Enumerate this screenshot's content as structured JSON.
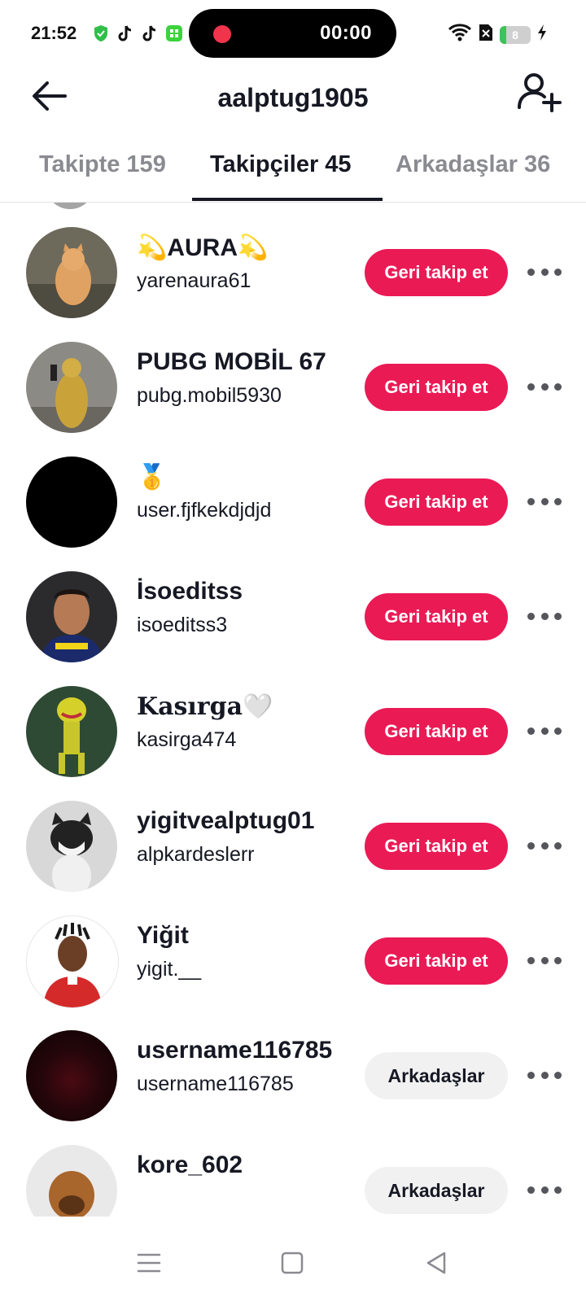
{
  "status_bar": {
    "time": "21:52",
    "recording_timer": "00:00",
    "battery_level": "8",
    "record_color": "#f0344c"
  },
  "header": {
    "title": "aalptug1905",
    "back_icon": "arrow-left-icon",
    "add_icon": "add-user-icon"
  },
  "tabs": [
    {
      "label": "Takipte 159",
      "active": false
    },
    {
      "label": "Takipçiler 45",
      "active": true
    },
    {
      "label": "Arkadaşlar 36",
      "active": false
    }
  ],
  "follow_color": "#ea1a55",
  "rows": [
    {
      "name": "💫AURA💫",
      "handle": "yarenaura61",
      "button": "Geri takip et",
      "type": "follow-back"
    },
    {
      "name": "PUBG MOBİL 67",
      "handle": "pubg.mobil5930",
      "button": "Geri takip et",
      "type": "follow-back"
    },
    {
      "name": "🥇",
      "handle": "user.fjfkekdjdjd",
      "button": "Geri takip et",
      "type": "follow-back"
    },
    {
      "name": "İsoeditss",
      "handle": "isoeditss3",
      "button": "Geri takip et",
      "type": "follow-back"
    },
    {
      "name": "Kasırga🤍",
      "handle": "kasirga474",
      "button": "Geri takip et",
      "type": "follow-back"
    },
    {
      "name": "yigitvealptug01",
      "handle": "alpkardeslerr",
      "button": "Geri takip et",
      "type": "follow-back"
    },
    {
      "name": "Yiğit",
      "handle": "yigit.__",
      "button": "Geri takip et",
      "type": "follow-back"
    },
    {
      "name": "username116785",
      "handle": "username116785",
      "button": "Arkadaşlar",
      "type": "friends"
    },
    {
      "name": "kore_602",
      "handle": "",
      "button": "Arkadaşlar",
      "type": "friends"
    }
  ],
  "nav": {
    "menu_icon": "menu-icon",
    "home_icon": "home-square-icon",
    "back_icon": "back-triangle-icon"
  }
}
